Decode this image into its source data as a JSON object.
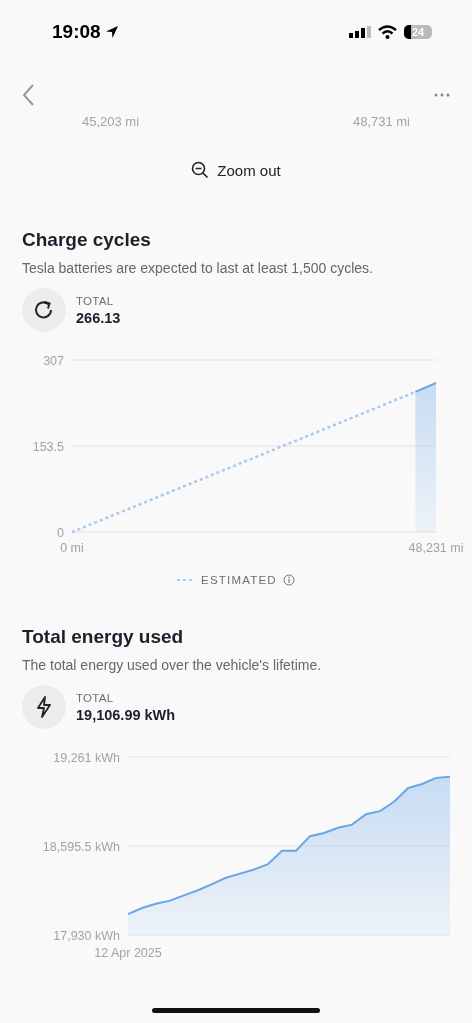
{
  "status_bar": {
    "time": "19:08",
    "battery": "24"
  },
  "previous_chart": {
    "range_labels": [
      "45,203 mi",
      "48,731 mi"
    ]
  },
  "zoom_button": {
    "label": "Zoom out"
  },
  "sections": [
    {
      "kind": "cycles",
      "title": "Charge cycles",
      "description": "Tesla batteries are expected to last at least 1,500 cycles.",
      "total_label": "TOTAL",
      "total_value": "266.13",
      "chart_data": {
        "type": "line",
        "x": [
          0,
          45500,
          48231
        ],
        "xlim": [
          0,
          48231
        ],
        "ylim": [
          0,
          307
        ],
        "yticks": [
          0,
          153.5,
          307
        ],
        "xticks": [
          {
            "value": 0,
            "label": "0 mi"
          },
          {
            "value": 48231,
            "label": "48,231 mi"
          }
        ],
        "series": [
          {
            "name": "ESTIMATED",
            "line_style": "dashed",
            "color": "#a9c9ee",
            "values": [
              0,
              250,
              null
            ]
          },
          {
            "type": "area",
            "color": "#6aa5e6",
            "values": [
              null,
              250,
              266
            ]
          }
        ]
      }
    },
    {
      "kind": "energy",
      "title": "Total energy used",
      "description": "The total energy used over the vehicle's lifetime.",
      "total_label": "TOTAL",
      "total_value": "19,106.99 kWh",
      "chart_data": {
        "type": "area",
        "ylim": [
          17930,
          19261
        ],
        "yticks": [
          {
            "value": 17930,
            "label": "17,930 kWh"
          },
          {
            "value": 18595.5,
            "label": "18,595.5 kWh"
          },
          {
            "value": 19261,
            "label": "19,261 kWh"
          }
        ],
        "annotations": [
          "12 Apr 2025"
        ],
        "series": [
          {
            "color": "#6aa5e6",
            "values": [
              18086,
              18132,
              18164,
              18187,
              18226,
              18265,
              18311,
              18358,
              18389,
              18420,
              18459,
              18560,
              18560,
              18669,
              18693,
              18732,
              18755,
              18833,
              18856,
              18926,
              19028,
              19059,
              19105,
              19113
            ]
          }
        ]
      }
    }
  ]
}
